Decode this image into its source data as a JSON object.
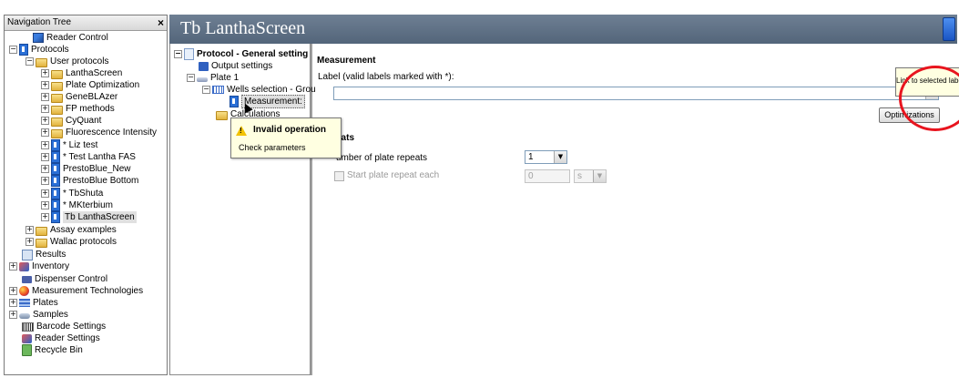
{
  "nav": {
    "header": "Navigation Tree",
    "close": "×",
    "items": [
      {
        "label": "Reader Control"
      },
      {
        "label": "Protocols"
      },
      {
        "label": "User protocols"
      },
      {
        "label": "LanthaScreen"
      },
      {
        "label": "Plate Optimization"
      },
      {
        "label": "GeneBLAzer"
      },
      {
        "label": "FP methods"
      },
      {
        "label": "CyQuant"
      },
      {
        "label": "Fluorescence Intensity"
      },
      {
        "label": "* Liz test"
      },
      {
        "label": "* Test Lantha FAS"
      },
      {
        "label": "PrestoBlue_New"
      },
      {
        "label": "PrestoBlue Bottom"
      },
      {
        "label": "* TbShuta"
      },
      {
        "label": "* MKterbium"
      },
      {
        "label": "Tb LanthaScreen"
      },
      {
        "label": "Assay examples"
      },
      {
        "label": "Wallac protocols"
      },
      {
        "label": "Results"
      },
      {
        "label": "Inventory"
      },
      {
        "label": "Dispenser Control"
      },
      {
        "label": "Measurement Technologies"
      },
      {
        "label": "Plates"
      },
      {
        "label": "Samples"
      },
      {
        "label": "Barcode Settings"
      },
      {
        "label": "Reader Settings"
      },
      {
        "label": "Recycle Bin"
      }
    ]
  },
  "title": "Tb LanthaScreen",
  "protocol_tree": {
    "root": "Protocol - General setting",
    "output": "Output settings",
    "plate": "Plate 1",
    "wells": "Wells selection - Grou",
    "measurement": "Measurement:",
    "calculations": "Calculations"
  },
  "measurement": {
    "section": "Measurement",
    "label_caption": "Label (valid labels marked with *):",
    "label_value": "",
    "optimizations_button": "Optimizations"
  },
  "repeats": {
    "section": "eats",
    "number_label": "umber of plate repeats",
    "number_value": "1",
    "start_label": "Start plate repeat each",
    "start_value": "0",
    "unit_value": "s"
  },
  "tooltips": {
    "invalid_title": "Invalid operation",
    "invalid_msg": "Check parameters",
    "link": "Link to selected label"
  }
}
